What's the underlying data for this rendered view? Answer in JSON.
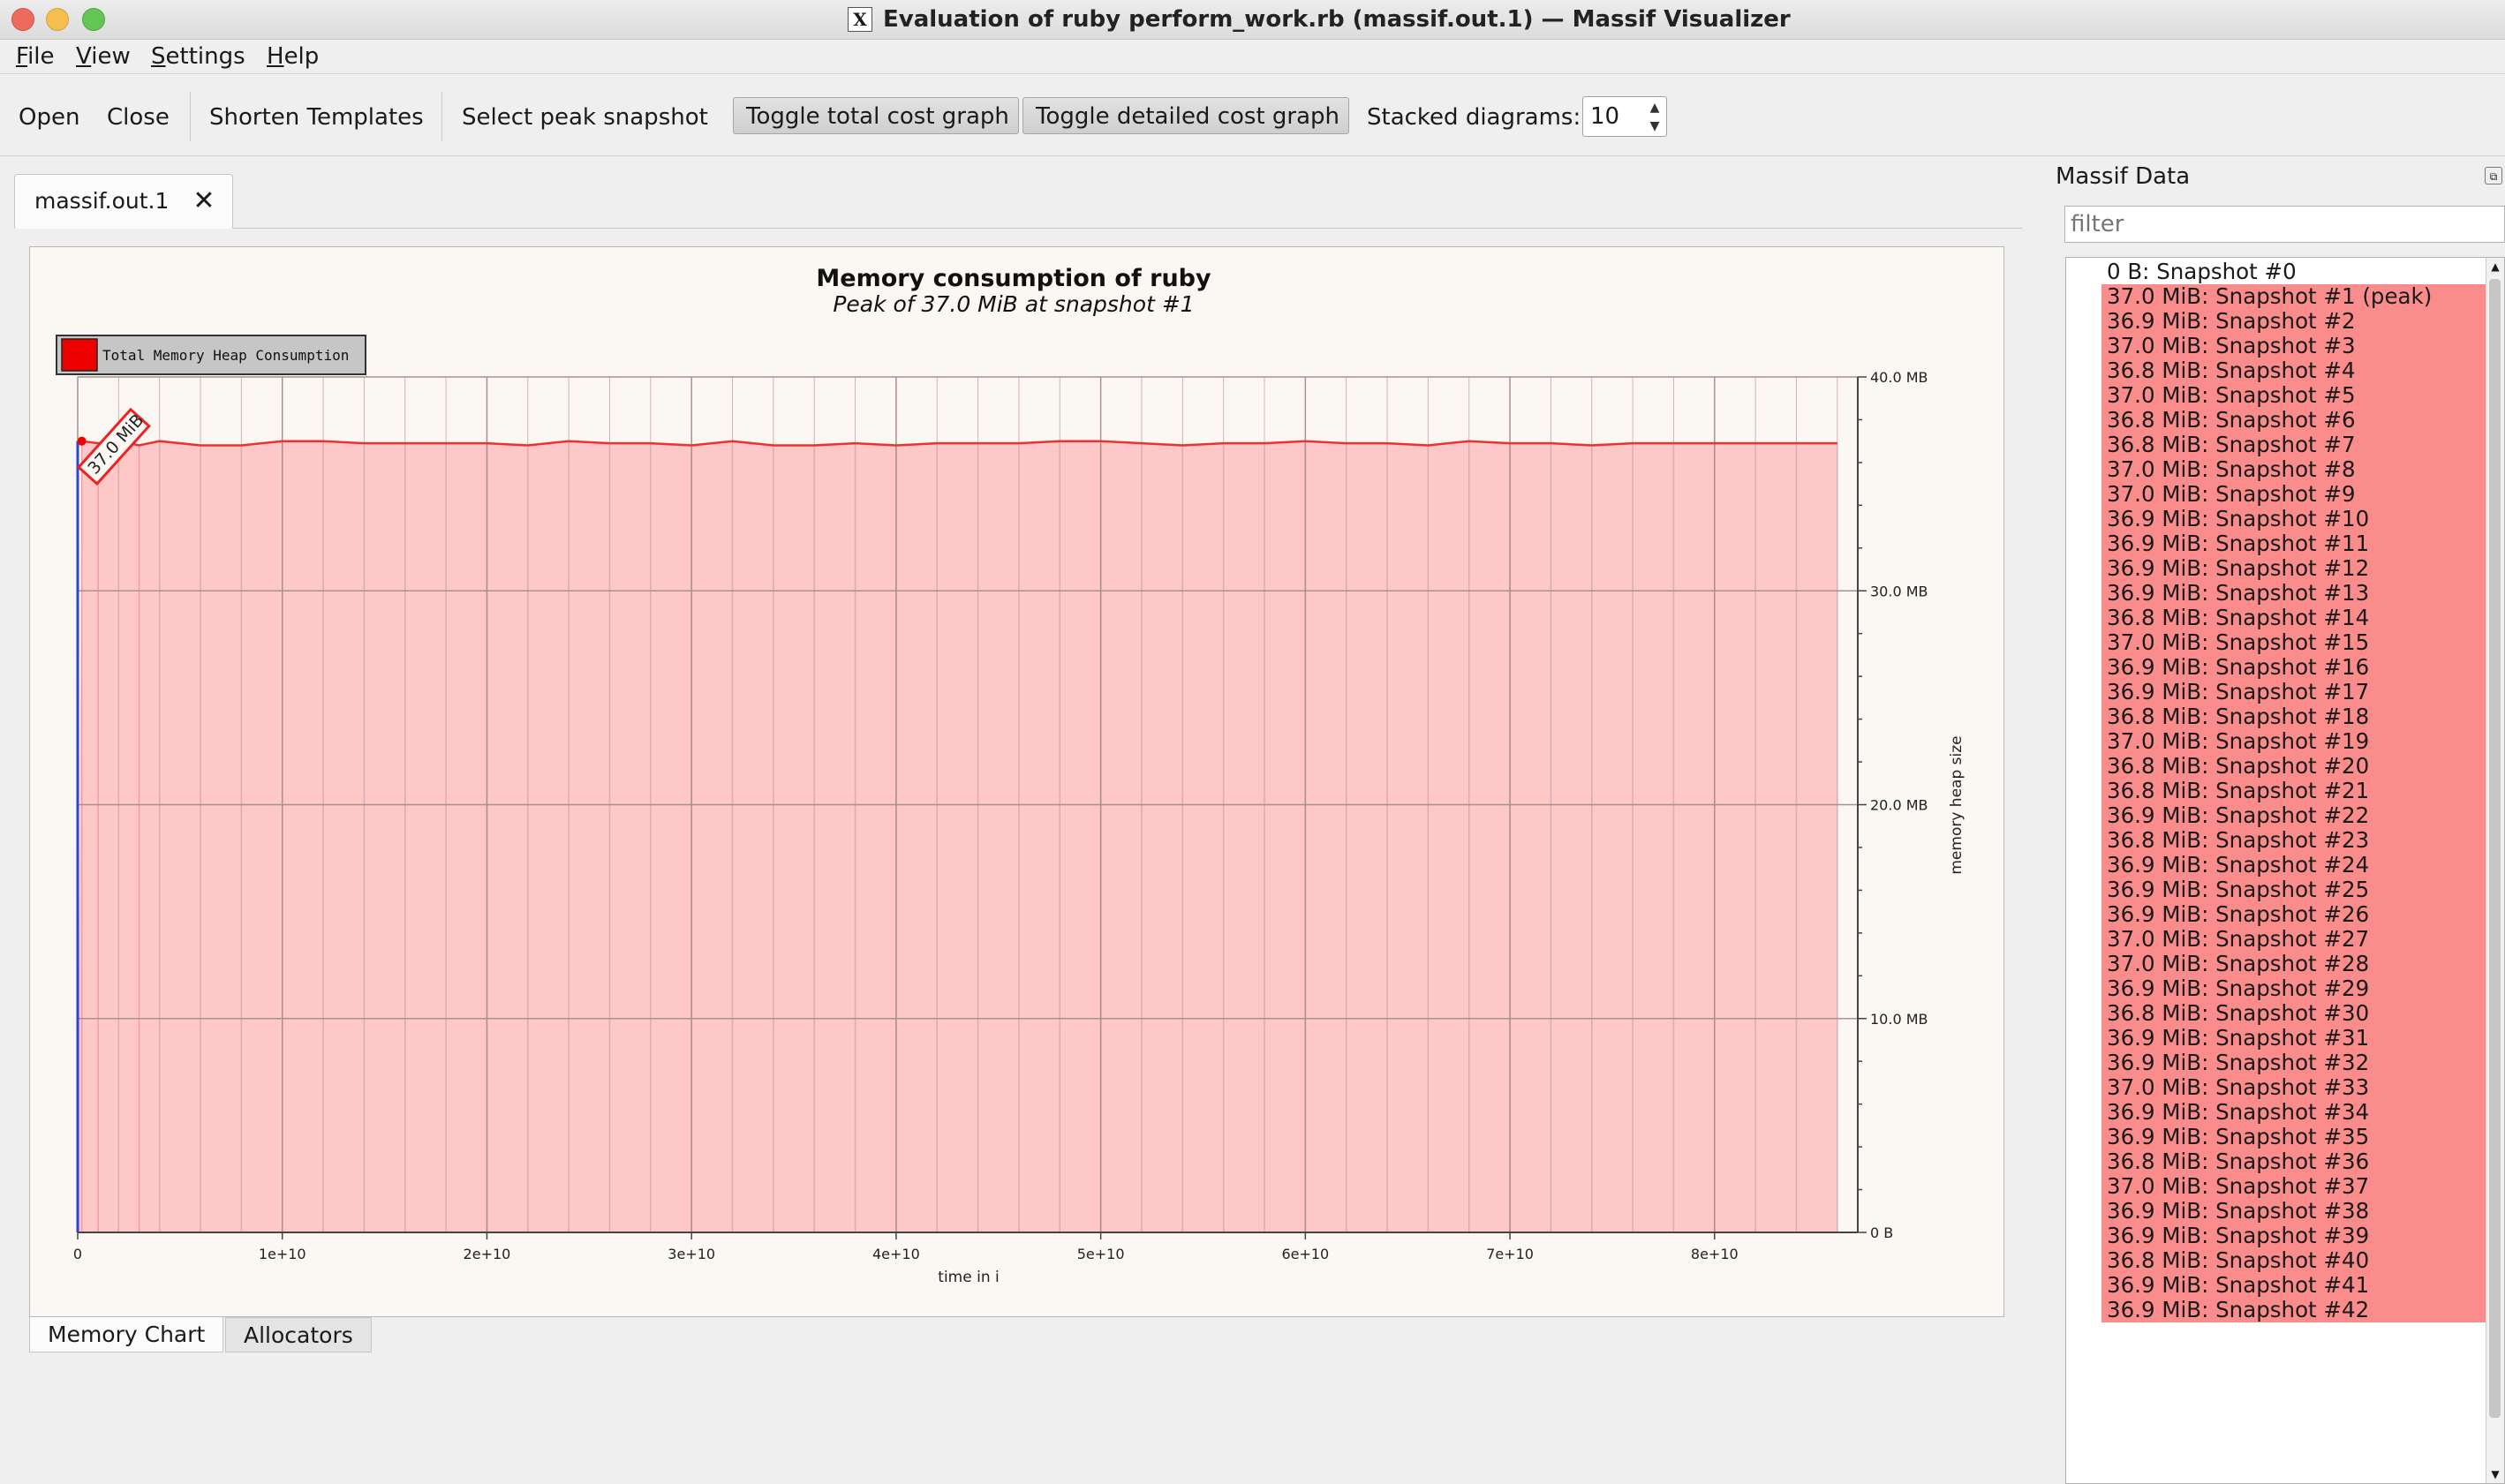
{
  "window": {
    "title": "Evaluation of ruby perform_work.rb (massif.out.1) — Massif Visualizer",
    "app_icon": "x11-icon"
  },
  "menu": {
    "items": [
      {
        "label": "File",
        "underline": "F",
        "rest": "ile"
      },
      {
        "label": "View",
        "underline": "V",
        "rest": "iew"
      },
      {
        "label": "Settings",
        "underline": "S",
        "rest": "ettings"
      },
      {
        "label": "Help",
        "underline": "H",
        "rest": "elp"
      }
    ]
  },
  "toolbar": {
    "open": "Open",
    "close": "Close",
    "shorten_templates": "Shorten Templates",
    "select_peak": "Select peak snapshot",
    "toggle_total": "Toggle total cost graph",
    "toggle_detailed": "Toggle detailed cost graph",
    "stacked_label": "Stacked diagrams:",
    "stacked_value": "10"
  },
  "doc_tab": {
    "label": "massif.out.1",
    "close_icon": "close-icon"
  },
  "bottom_tabs": [
    "Memory Chart",
    "Allocators"
  ],
  "dock": {
    "title": "Massif Data",
    "filter_placeholder": "filter",
    "snapshots": [
      {
        "label": "0 B: Snapshot #0",
        "heap": false
      },
      {
        "label": "37.0 MiB: Snapshot #1 (peak)",
        "heap": true
      },
      {
        "label": "36.9 MiB: Snapshot #2",
        "heap": true
      },
      {
        "label": "37.0 MiB: Snapshot #3",
        "heap": true
      },
      {
        "label": "36.8 MiB: Snapshot #4",
        "heap": true
      },
      {
        "label": "37.0 MiB: Snapshot #5",
        "heap": true
      },
      {
        "label": "36.8 MiB: Snapshot #6",
        "heap": true
      },
      {
        "label": "36.8 MiB: Snapshot #7",
        "heap": true
      },
      {
        "label": "37.0 MiB: Snapshot #8",
        "heap": true
      },
      {
        "label": "37.0 MiB: Snapshot #9",
        "heap": true
      },
      {
        "label": "36.9 MiB: Snapshot #10",
        "heap": true
      },
      {
        "label": "36.9 MiB: Snapshot #11",
        "heap": true
      },
      {
        "label": "36.9 MiB: Snapshot #12",
        "heap": true
      },
      {
        "label": "36.9 MiB: Snapshot #13",
        "heap": true
      },
      {
        "label": "36.8 MiB: Snapshot #14",
        "heap": true
      },
      {
        "label": "37.0 MiB: Snapshot #15",
        "heap": true
      },
      {
        "label": "36.9 MiB: Snapshot #16",
        "heap": true
      },
      {
        "label": "36.9 MiB: Snapshot #17",
        "heap": true
      },
      {
        "label": "36.8 MiB: Snapshot #18",
        "heap": true
      },
      {
        "label": "37.0 MiB: Snapshot #19",
        "heap": true
      },
      {
        "label": "36.8 MiB: Snapshot #20",
        "heap": true
      },
      {
        "label": "36.8 MiB: Snapshot #21",
        "heap": true
      },
      {
        "label": "36.9 MiB: Snapshot #22",
        "heap": true
      },
      {
        "label": "36.8 MiB: Snapshot #23",
        "heap": true
      },
      {
        "label": "36.9 MiB: Snapshot #24",
        "heap": true
      },
      {
        "label": "36.9 MiB: Snapshot #25",
        "heap": true
      },
      {
        "label": "36.9 MiB: Snapshot #26",
        "heap": true
      },
      {
        "label": "37.0 MiB: Snapshot #27",
        "heap": true
      },
      {
        "label": "37.0 MiB: Snapshot #28",
        "heap": true
      },
      {
        "label": "36.9 MiB: Snapshot #29",
        "heap": true
      },
      {
        "label": "36.8 MiB: Snapshot #30",
        "heap": true
      },
      {
        "label": "36.9 MiB: Snapshot #31",
        "heap": true
      },
      {
        "label": "36.9 MiB: Snapshot #32",
        "heap": true
      },
      {
        "label": "37.0 MiB: Snapshot #33",
        "heap": true
      },
      {
        "label": "36.9 MiB: Snapshot #34",
        "heap": true
      },
      {
        "label": "36.9 MiB: Snapshot #35",
        "heap": true
      },
      {
        "label": "36.8 MiB: Snapshot #36",
        "heap": true
      },
      {
        "label": "37.0 MiB: Snapshot #37",
        "heap": true
      },
      {
        "label": "36.9 MiB: Snapshot #38",
        "heap": true
      },
      {
        "label": "36.9 MiB: Snapshot #39",
        "heap": true
      },
      {
        "label": "36.8 MiB: Snapshot #40",
        "heap": true
      },
      {
        "label": "36.9 MiB: Snapshot #41",
        "heap": true
      },
      {
        "label": "36.9 MiB: Snapshot #42",
        "heap": true
      }
    ]
  },
  "colors": {
    "heap_fill": "#ffc8c8",
    "heap_line": "#f03030",
    "list_highlight": "#fa8c8c",
    "legend_swatch": "#ee0000"
  },
  "chart_data": {
    "type": "area",
    "title": "Memory consumption of ruby",
    "subtitle": "Peak of 37.0 MiB at snapshot #1",
    "xlabel": "time in i",
    "ylabel": "memory heap size",
    "legend": "Total Memory Heap Consumption",
    "legend_placement": "top-left",
    "peak_label": "37.0 MiB",
    "x_ticks": [
      "0",
      "1e+10",
      "2e+10",
      "3e+10",
      "4e+10",
      "5e+10",
      "6e+10",
      "7e+10",
      "8e+10"
    ],
    "y_ticks": [
      "0 B",
      "10.0 MB",
      "20.0 MB",
      "30.0 MB",
      "40.0 MB"
    ],
    "xlim": [
      0,
      87000000000.0
    ],
    "ylim": [
      0,
      40.0
    ],
    "y_unit": "MB",
    "grid": true,
    "series": [
      {
        "name": "Total Memory Heap Consumption",
        "x": [
          0,
          200000000.0,
          1000000000.0,
          2000000000.0,
          3000000000.0,
          4000000000.0,
          6000000000.0,
          8000000000.0,
          10000000000.0,
          12000000000.0,
          14000000000.0,
          16000000000.0,
          18000000000.0,
          20000000000.0,
          22000000000.0,
          24000000000.0,
          26000000000.0,
          28000000000.0,
          30000000000.0,
          32000000000.0,
          34000000000.0,
          36000000000.0,
          38000000000.0,
          40000000000.0,
          42000000000.0,
          44000000000.0,
          46000000000.0,
          48000000000.0,
          50000000000.0,
          52000000000.0,
          54000000000.0,
          56000000000.0,
          58000000000.0,
          60000000000.0,
          62000000000.0,
          64000000000.0,
          66000000000.0,
          68000000000.0,
          70000000000.0,
          72000000000.0,
          74000000000.0,
          76000000000.0,
          78000000000.0,
          80000000000.0,
          82000000000.0,
          84000000000.0,
          86000000000.0
        ],
        "values": [
          0,
          37.0,
          36.9,
          37.0,
          36.8,
          37.0,
          36.8,
          36.8,
          37.0,
          37.0,
          36.9,
          36.9,
          36.9,
          36.9,
          36.8,
          37.0,
          36.9,
          36.9,
          36.8,
          37.0,
          36.8,
          36.8,
          36.9,
          36.8,
          36.9,
          36.9,
          36.9,
          37.0,
          37.0,
          36.9,
          36.8,
          36.9,
          36.9,
          37.0,
          36.9,
          36.9,
          36.8,
          37.0,
          36.9,
          36.9,
          36.8,
          36.9,
          36.9,
          36.9,
          36.9,
          36.9,
          36.9
        ]
      }
    ]
  }
}
